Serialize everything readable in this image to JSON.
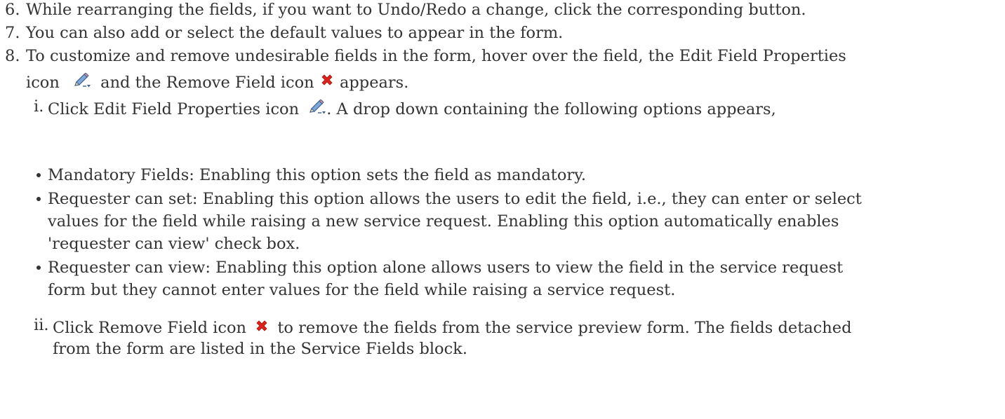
{
  "steps": [
    {
      "num": "6.",
      "text": "While rearranging the fields, if you want to Undo/Redo a change, click the corresponding button."
    },
    {
      "num": "7.",
      "text": "You can also add or select the default values to appear in the form."
    },
    {
      "num": "8.",
      "line1": "To customize and remove undesirable fields in the form, hover over the field, the Edit Field Properties",
      "line2_a": "icon",
      "line2_b": "and the Remove Field icon",
      "line2_c": "appears."
    }
  ],
  "sub_i": {
    "num": "i.",
    "text_a": "Click Edit Field Properties icon",
    "text_b": ".  A drop down containing the following options appears,"
  },
  "bullets": [
    {
      "lines": [
        "Mandatory Fields: Enabling this option sets the field as mandatory."
      ]
    },
    {
      "lines": [
        "Requester can set: Enabling this option allows the users to edit the field, i.e., they can enter or select",
        "values for the field while raising a new service request. Enabling this option automatically enables",
        "'requester can view' check box."
      ]
    },
    {
      "lines": [
        "Requester can view: Enabling this option alone allows users to view the field in the service request",
        "form but they cannot enter values for the field while raising a service request."
      ]
    }
  ],
  "sub_ii": {
    "num": "ii.",
    "text_a": "Click Remove Field icon",
    "text_b": "to remove the fields from the service preview form. The fields detached",
    "line2": "from the form are listed in the Service Fields block."
  },
  "icons": {
    "edit": "edit-field-properties-icon",
    "remove": "remove-field-icon",
    "remove_color": "#d9231d"
  }
}
